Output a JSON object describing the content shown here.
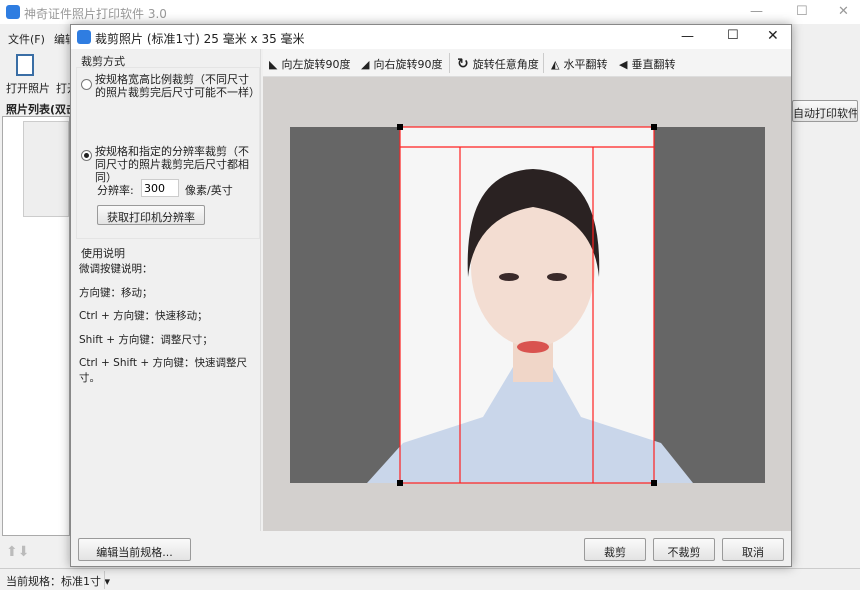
{
  "main": {
    "title": "神奇证件照片打印软件 3.0",
    "menu": [
      "文件(F)",
      "编辑"
    ],
    "toolbar": [
      "打开照片",
      "打开"
    ],
    "list_header": "照片列表(双击",
    "right_button": "自动打印软件",
    "status_label": "当前规格：标准1寸"
  },
  "dialog": {
    "title": "裁剪照片 (标准1寸) 25 毫米 x 35 毫米",
    "crop_mode_title": "裁剪方式",
    "option1": "按规格宽高比例裁剪（不同尺寸的照片裁剪完后尺寸可能不一样）",
    "option2": "按规格和指定的分辨率裁剪（不同尺寸的照片裁剪完后尺寸都相同）",
    "selected_option": 2,
    "resolution_label": "分辨率:",
    "resolution_value": "300",
    "resolution_unit": "像素/英寸",
    "get_printer_res": "获取打印机分辨率",
    "help_title": "使用说明",
    "help_lines": [
      "微调按键说明：",
      "方向键：移动；",
      "Ctrl + 方向键：快速移动；",
      "Shift + 方向键：调整尺寸；",
      "Ctrl + Shift + 方向键：快速调整尺寸。"
    ],
    "tools": [
      "向左旋转90度",
      "向右旋转90度",
      "旋转任意角度",
      "水平翻转",
      "垂直翻转"
    ],
    "edit_spec": "编辑当前规格...",
    "crop": "裁剪",
    "no_crop": "不裁剪",
    "cancel": "取消"
  },
  "colors": {
    "crop_line": "#ff2020",
    "canvas_bg": "#666666"
  }
}
